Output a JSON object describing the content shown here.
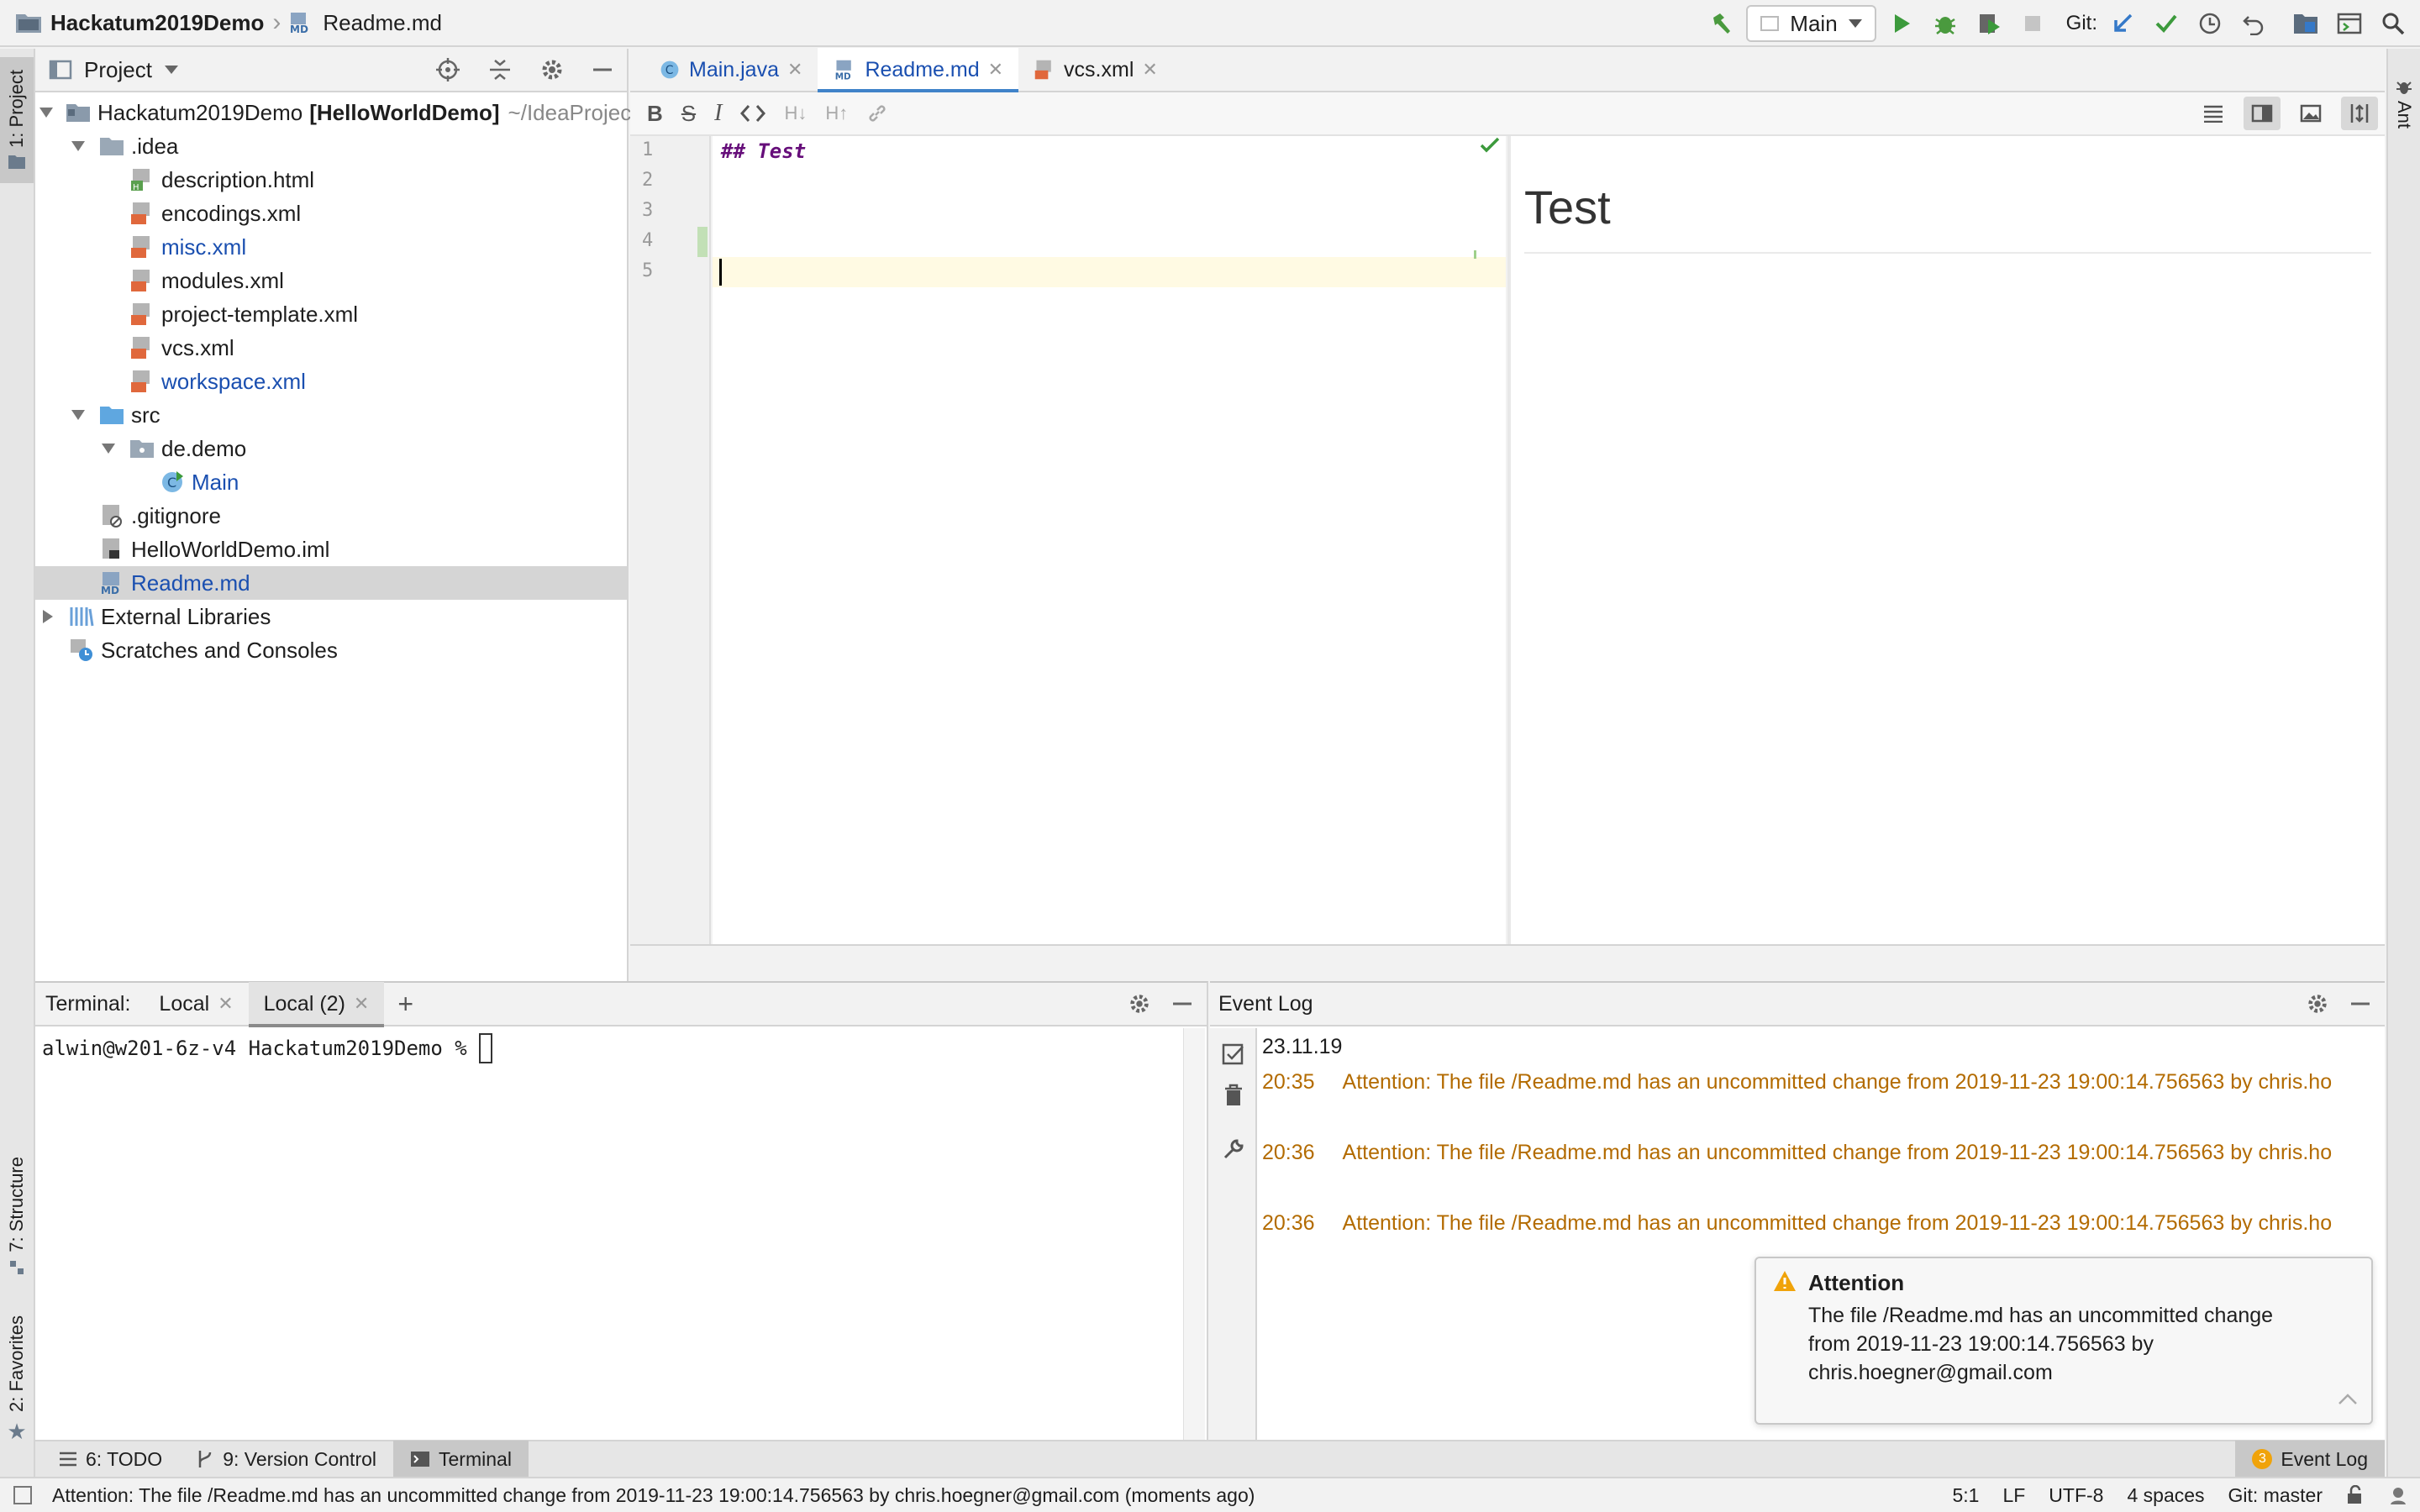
{
  "navbar": {
    "project_name": "Hackatum2019Demo",
    "file_name": "Readme.md",
    "run_config": "Main",
    "git_label": "Git:"
  },
  "left_stripe": {
    "project": "1: Project",
    "structure": "7: Structure",
    "favorites": "2: Favorites"
  },
  "right_stripe": {
    "ant": "Ant"
  },
  "project_panel": {
    "title": "Project",
    "root_name": "Hackatum2019Demo",
    "root_module": "[HelloWorldDemo]",
    "root_path": "~/IdeaProjec",
    "items": [
      {
        "label": "description.html"
      },
      {
        "label": "encodings.xml"
      },
      {
        "label": "misc.xml"
      },
      {
        "label": "modules.xml"
      },
      {
        "label": "project-template.xml"
      },
      {
        "label": "vcs.xml"
      },
      {
        "label": "workspace.xml"
      }
    ],
    "idea": ".idea",
    "src": "src",
    "package": "de.demo",
    "main_class": "Main",
    "gitignore": ".gitignore",
    "iml": "HelloWorldDemo.iml",
    "readme": "Readme.md",
    "external_libraries": "External Libraries",
    "scratches": "Scratches and Consoles"
  },
  "editor": {
    "tabs": [
      {
        "label": "Main.java"
      },
      {
        "label": "Readme.md"
      },
      {
        "label": "vcs.xml"
      }
    ],
    "line_numbers": [
      "1",
      "2",
      "3",
      "4",
      "5"
    ],
    "code_line_1": "## Test",
    "preview_heading": "Test"
  },
  "terminal": {
    "label": "Terminal:",
    "tab1": "Local",
    "tab2": "Local (2)",
    "prompt": "alwin@w201-6z-v4 Hackatum2019Demo % "
  },
  "event_log": {
    "title": "Event Log",
    "date": "23.11.19",
    "entries": [
      {
        "time": "20:35",
        "message": "Attention: The file /Readme.md has an uncommitted change from 2019-11-23 19:00:14.756563 by chris.ho"
      },
      {
        "time": "20:36",
        "message": "Attention: The file /Readme.md has an uncommitted change from 2019-11-23 19:00:14.756563 by chris.ho"
      },
      {
        "time": "20:36",
        "message": "Attention: The file /Readme.md has an uncommitted change from 2019-11-23 19:00:14.756563 by chris.ho"
      }
    ]
  },
  "notification": {
    "title": "Attention",
    "line1": "The file /Readme.md has an uncommitted change",
    "line2": "from 2019-11-23 19:00:14.756563 by",
    "line3": "chris.hoegner@gmail.com"
  },
  "tool_windows": {
    "todo": "6: TODO",
    "vcs": "9: Version Control",
    "terminal": "Terminal",
    "event_log_count": "3",
    "event_log": "Event Log"
  },
  "status_bar": {
    "message": "Attention: The file /Readme.md has an uncommitted change from 2019-11-23 19:00:14.756563 by chris.hoegner@gmail.com (moments ago)",
    "position": "5:1",
    "line_sep": "LF",
    "encoding": "UTF-8",
    "indent": "4 spaces",
    "branch": "Git: master"
  },
  "colors": {
    "accent": "#4083c9",
    "warning_text": "#b36b00",
    "modified_file": "#1a4fb0",
    "run_green": "#3c9a3c"
  }
}
